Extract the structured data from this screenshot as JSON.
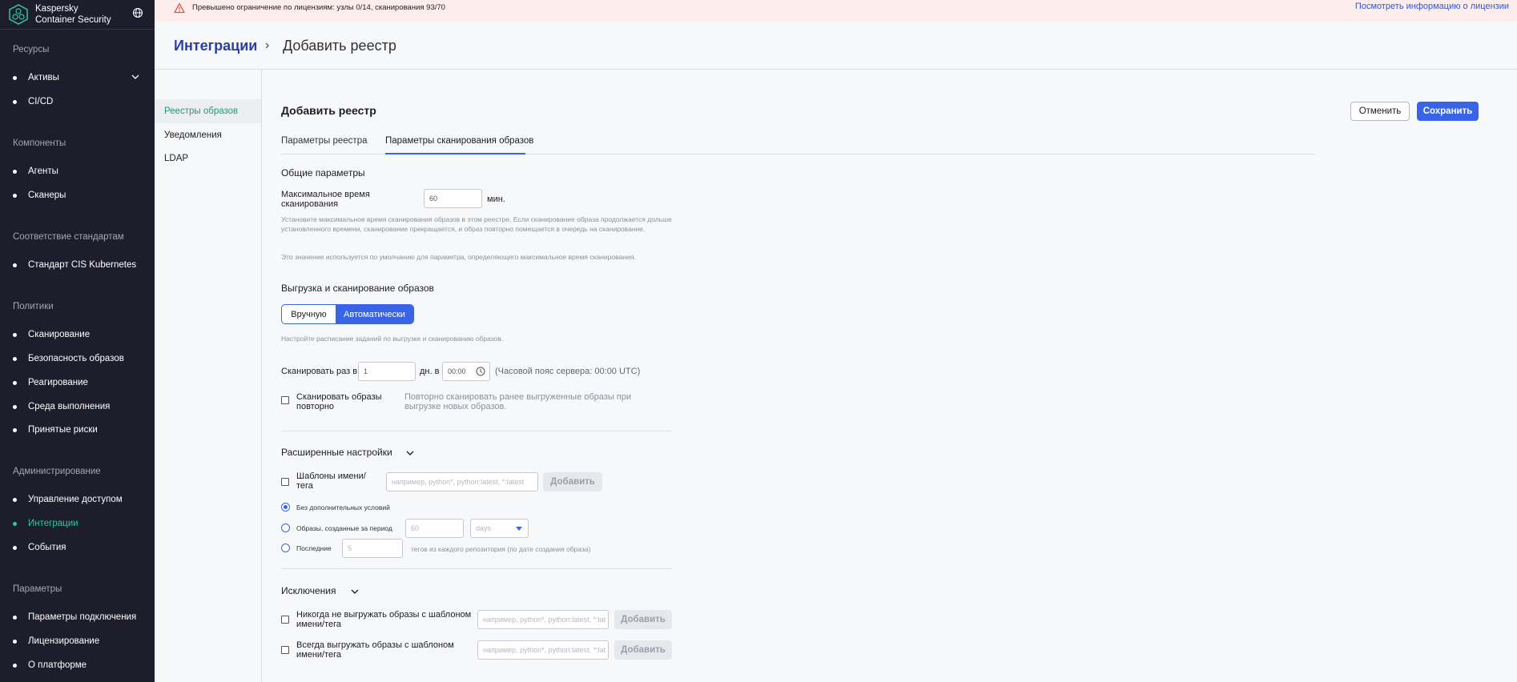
{
  "sidebar": {
    "brand_line1": "Kaspersky",
    "brand_line2": "Container Security",
    "sections": {
      "resources": "Ресурсы",
      "components": "Компоненты",
      "compliance": "Соответствие стандартам",
      "policies": "Политики",
      "admin": "Администрирование",
      "settings": "Параметры"
    },
    "items": {
      "assets": "Активы",
      "cicd": "CI/CD",
      "agents": "Агенты",
      "scanners": "Сканеры",
      "cis": "Стандарт CIS Kubernetes",
      "scanning": "Сканирование",
      "image_security": "Безопасность образов",
      "response": "Реагирование",
      "runtime": "Среда выполнения",
      "accepted_risks": "Принятые риски",
      "access": "Управление доступом",
      "integrations": "Интеграции",
      "events": "События",
      "connection": "Параметры подключения",
      "licensing": "Лицензирование",
      "about": "О платформе"
    }
  },
  "banner": {
    "text": "Превышено ограничение по лицензиям: узлы 0/14, сканирования 93/70",
    "link": "Посмотреть информацию о лицензии"
  },
  "breadcrumb": {
    "parent": "Интеграции",
    "separator": "›",
    "current": "Добавить реестр"
  },
  "subnav": {
    "registries": "Реестры образов",
    "notifications": "Уведомления",
    "ldap": "LDAP"
  },
  "form": {
    "title": "Добавить реестр",
    "cancel": "Отменить",
    "save": "Сохранить",
    "tabs": {
      "registry_params": "Параметры реестра",
      "scan_params": "Параметры сканирования образов"
    },
    "general": {
      "title": "Общие параметры",
      "max_time_label": "Максимальное время сканирования",
      "max_time_value": "60",
      "max_time_unit": "мин.",
      "hint1": "Установите максимальное время сканирования образов в этом реестре. Если сканирование образа продолжается дольше установленного времени, сканирование прекращается, и образ повторно помещается в очередь на сканирование.",
      "hint2": "Это значение используется по умолчанию для параметра, определяющего максимальное время сканирования."
    },
    "pull": {
      "title": "Выгрузка и сканирование образов",
      "manual": "Вручную",
      "auto": "Автоматически",
      "hint": "Настройте расписание заданий по выгрузке и сканированию образов.",
      "scan_every_label": "Сканировать раз в",
      "scan_every_value": "1",
      "days_at": "дн. в",
      "time_value": "00:00",
      "timezone": "(Часовой пояс сервера: 00:00 UTC)",
      "rescan_label": "Сканировать образы повторно",
      "rescan_hint": "Повторно сканировать ранее выгруженные образы при выгрузке новых образов."
    },
    "advanced": {
      "title": "Расширенные настройки",
      "name_tag_label": "Шаблоны имени/тега",
      "name_tag_placeholder": "например, python*, python:latest, *:latest",
      "add": "Добавить",
      "opt_none": "Без дополнительных условий",
      "opt_period": "Образы, созданные за период",
      "period_placeholder": "60",
      "period_unit": "days",
      "opt_last": "Последние",
      "last_placeholder": "5",
      "last_suffix": "тегов из каждого репозитория (по дате создания образа)"
    },
    "exclusions": {
      "title": "Исключения",
      "never_label": "Никогда не выгружать образы с шаблоном имени/тега",
      "always_label": "Всегда выгружать образы с шаблоном имени/тега",
      "placeholder": "например, python*, python:latest, *:lat",
      "add": "Добавить"
    }
  }
}
